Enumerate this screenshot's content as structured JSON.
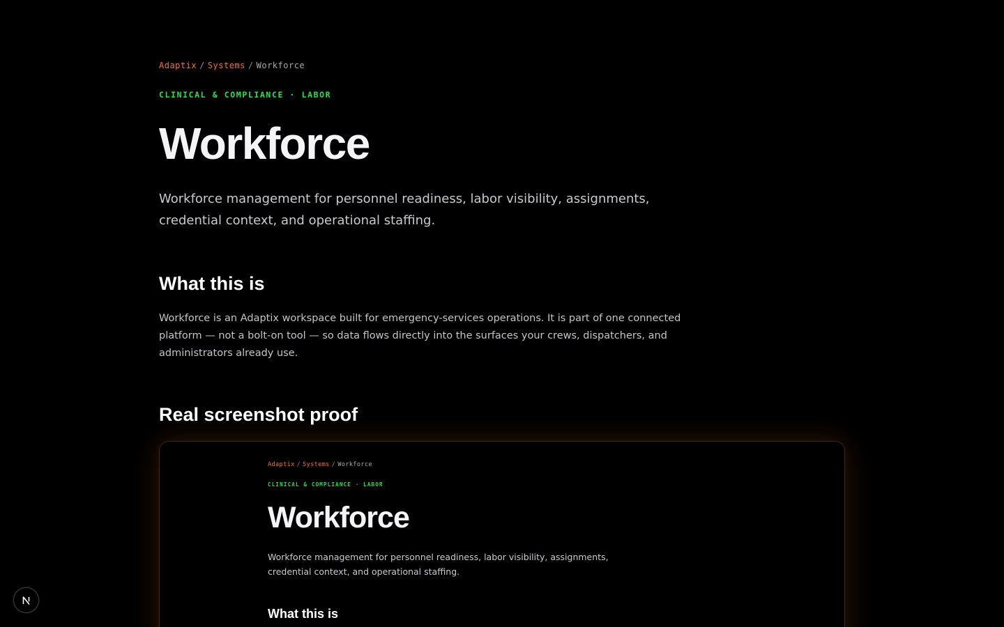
{
  "breadcrumb": {
    "items": [
      {
        "label": "Adaptix"
      },
      {
        "label": "Systems"
      },
      {
        "label": "Workforce"
      }
    ],
    "separator": "/"
  },
  "eyebrow": "CLINICAL & COMPLIANCE · LABOR",
  "title": "Workforce",
  "lead": "Workforce management for personnel readiness, labor visibility, assignments, credential context, and operational staffing.",
  "sections": {
    "what": {
      "heading": "What this is",
      "body": "Workforce is an Adaptix workspace built for emergency-services operations. It is part of one connected platform — not a bolt-on tool — so data flows directly into the surfaces your crews, dispatchers, and administrators already use."
    },
    "proof": {
      "heading": "Real screenshot proof"
    }
  },
  "screenshot": {
    "breadcrumb": {
      "items": [
        {
          "label": "Adaptix"
        },
        {
          "label": "Systems"
        },
        {
          "label": "Workforce"
        }
      ],
      "separator": "/"
    },
    "eyebrow": "CLINICAL & COMPLIANCE · LABOR",
    "title": "Workforce",
    "lead": "Workforce management for personnel readiness, labor visibility, assignments, credential context, and operational staffing.",
    "heading": "What this is"
  },
  "dev_badge": {
    "icon": "nextjs-n-icon",
    "letter": "N"
  },
  "colors": {
    "background": "#000000",
    "accent_orange": "#f0722d",
    "accent_green": "#22e14a",
    "text_primary": "#f4f4f6",
    "text_secondary": "#c9c9cd",
    "frame_glow": "#f0722d"
  }
}
